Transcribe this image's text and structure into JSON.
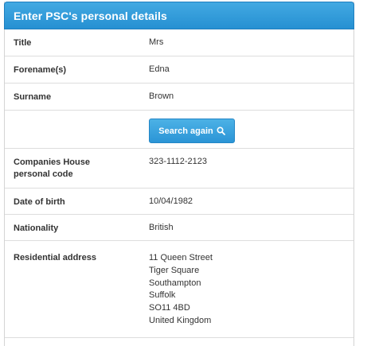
{
  "panel": {
    "title": "Enter PSC's personal details"
  },
  "details": {
    "title": {
      "label": "Title",
      "value": "Mrs"
    },
    "forename": {
      "label": "Forename(s)",
      "value": "Edna"
    },
    "surname": {
      "label": "Surname",
      "value": "Brown"
    },
    "search_button": {
      "label": "Search again",
      "icon": "search-icon"
    },
    "personal_code": {
      "label_line1": "Companies House",
      "label_line2": "personal code",
      "value": "323-1112-2123"
    },
    "date_of_birth": {
      "label": "Date of birth",
      "value": "10/04/1982"
    },
    "nationality": {
      "label": "Nationality",
      "value": "British"
    },
    "residential_address": {
      "label": "Residential address",
      "lines": [
        "11 Queen Street",
        "Tiger Square",
        "Southampton",
        "Suffolk",
        "SO11 4BD",
        "United Kingdom"
      ]
    }
  },
  "colors": {
    "header_bg": "#2f9ad8",
    "button_bg": "#3aa4de",
    "text": "#333333",
    "divider": "#dddddd"
  }
}
